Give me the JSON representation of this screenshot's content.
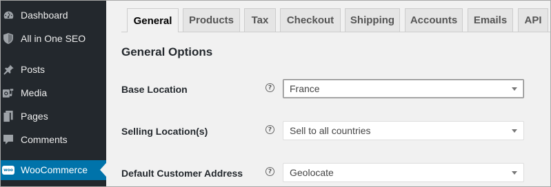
{
  "sidebar": {
    "items": [
      {
        "label": "Dashboard",
        "icon": "dashboard-icon"
      },
      {
        "label": "All in One SEO",
        "icon": "shield-icon"
      },
      {
        "label": "Posts",
        "icon": "pin-icon"
      },
      {
        "label": "Media",
        "icon": "media-icon"
      },
      {
        "label": "Pages",
        "icon": "pages-icon"
      },
      {
        "label": "Comments",
        "icon": "comment-icon"
      },
      {
        "label": "WooCommerce",
        "icon": "woocommerce-icon",
        "icon_text": "woo",
        "active": true
      }
    ]
  },
  "tabs": [
    {
      "label": "General",
      "active": true
    },
    {
      "label": "Products"
    },
    {
      "label": "Tax"
    },
    {
      "label": "Checkout"
    },
    {
      "label": "Shipping"
    },
    {
      "label": "Accounts"
    },
    {
      "label": "Emails"
    },
    {
      "label": "API"
    }
  ],
  "main": {
    "section_title": "General Options",
    "help_glyph": "?",
    "fields": [
      {
        "label": "Base Location",
        "value": "France"
      },
      {
        "label": "Selling Location(s)",
        "value": "Sell to all countries"
      },
      {
        "label": "Default Customer Address",
        "value": "Geolocate"
      }
    ]
  },
  "colors": {
    "sidebar_bg": "#23282d",
    "active_menu": "#0073aa",
    "page_bg": "#f1f1f1"
  }
}
